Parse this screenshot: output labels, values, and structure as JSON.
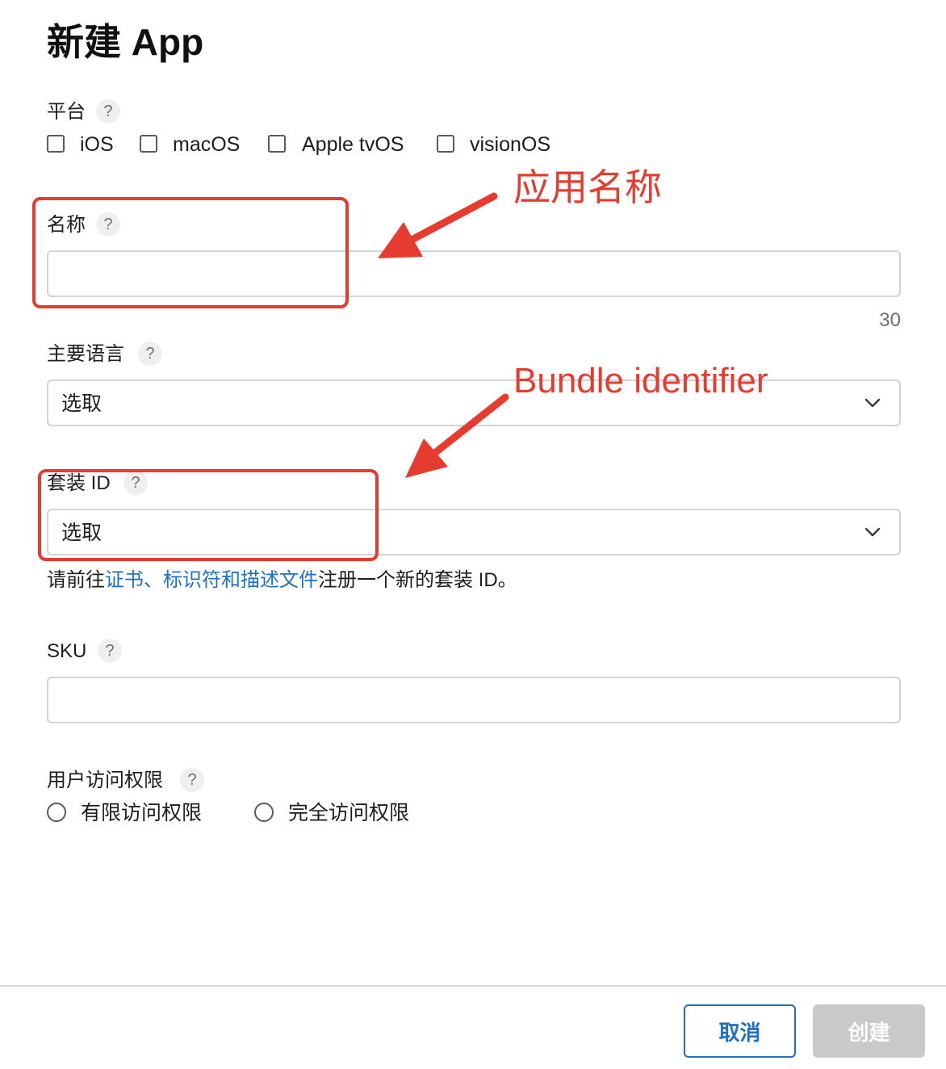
{
  "dialog": {
    "title": "新建 App",
    "platform": {
      "label": "平台",
      "help": "?",
      "options": [
        "iOS",
        "macOS",
        "Apple tvOS",
        "visionOS"
      ]
    },
    "name": {
      "label": "名称",
      "help": "?",
      "value": "",
      "counter": "30"
    },
    "primary_language": {
      "label": "主要语言",
      "help": "?",
      "selected": "选取"
    },
    "bundle_id": {
      "label": "套装 ID",
      "help": "?",
      "selected": "选取",
      "hint_before": "请前往",
      "hint_link": "证书、标识符和描述文件",
      "hint_after": "注册一个新的套装 ID。"
    },
    "sku": {
      "label": "SKU",
      "help": "?",
      "value": ""
    },
    "user_access": {
      "label": "用户访问权限",
      "help": "?",
      "options": [
        "有限访问权限",
        "完全访问权限"
      ]
    },
    "buttons": {
      "cancel": "取消",
      "create": "创建"
    }
  },
  "annotations": {
    "app_name": "应用名称",
    "bundle_identifier": "Bundle identifier",
    "color": "#e63c2f"
  },
  "colors": {
    "link": "#1f6fc5",
    "disabled_button": "#c9c9c9"
  }
}
